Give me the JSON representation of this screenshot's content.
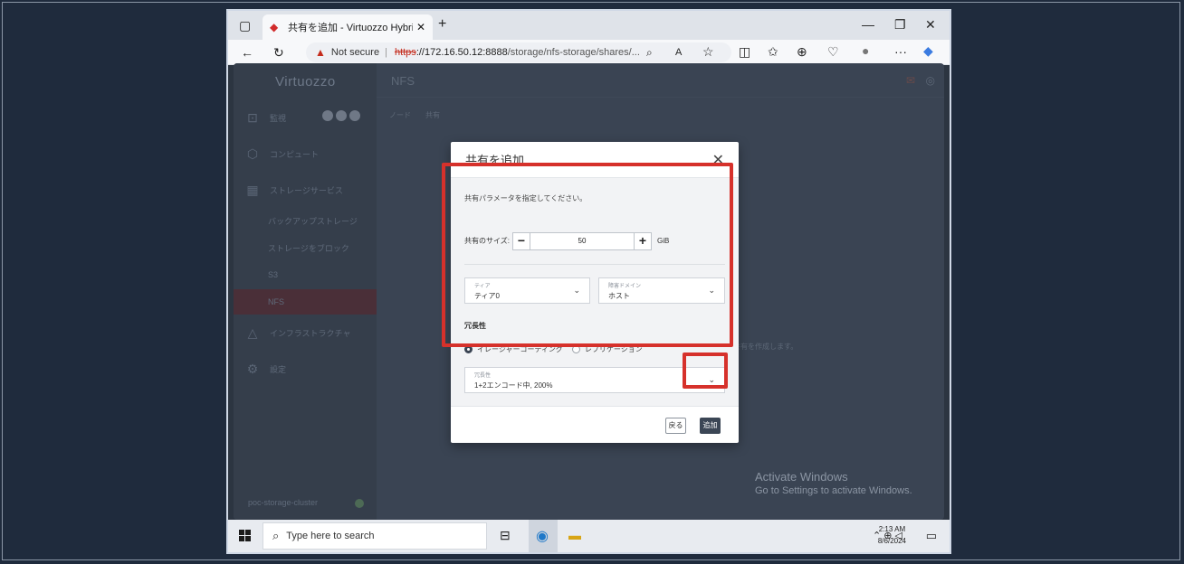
{
  "browser": {
    "tab_title": "共有を追加 - Virtuozzo Hybrid In",
    "tab_close": "✕",
    "new_tab": "+",
    "security_label": "Not secure",
    "url_scheme": "https",
    "url_host": "://172.16.50.12",
    "url_port": ":8888",
    "url_path": "/storage/nfs-storage/shares/...",
    "more": "···"
  },
  "sidebar": {
    "logo": "Virtuozzo",
    "items": [
      {
        "label": "監視",
        "icon": "monitor-icon"
      },
      {
        "label": "コンピュート",
        "icon": "cube-icon"
      },
      {
        "label": "ストレージサービス",
        "icon": "grid-icon"
      },
      {
        "label": "インフラストラクチャ",
        "icon": "infrastructure-icon"
      },
      {
        "label": "設定",
        "icon": "gear-icon"
      }
    ],
    "sub_items": [
      "バックアップストレージ",
      "ストレージをブロック",
      "S3",
      "NFS"
    ],
    "cluster": "poc-storage-cluster"
  },
  "main": {
    "title": "NFS",
    "subtabs": [
      "ノード",
      "共有"
    ],
    "ghost_text": "…に共有を作成します。"
  },
  "modal": {
    "title": "共有を追加",
    "close": "✕",
    "instruction": "共有パラメータを指定してください。",
    "size_label": "共有のサイズ:",
    "size_value": "50",
    "size_unit": "GiB",
    "minus": "−",
    "plus": "+",
    "tier_label": "ティア",
    "tier_value": "ティア0",
    "failure_domain_label": "障害ドメイン",
    "failure_domain_value": "ホスト",
    "redundancy_title": "冗長性",
    "radio_erasure": "イレージャーコーディング",
    "radio_replication": "レプリケーション",
    "redundancy_label": "冗長性",
    "redundancy_value": "1+2エンコード中, 200%",
    "back_button": "戻る",
    "add_button": "追加"
  },
  "watermark": {
    "line1": "Activate Windows",
    "line2": "Go to Settings to activate Windows."
  },
  "taskbar": {
    "search_placeholder": "Type here to search",
    "time": "2:13 AM",
    "date": "8/6/2024"
  }
}
